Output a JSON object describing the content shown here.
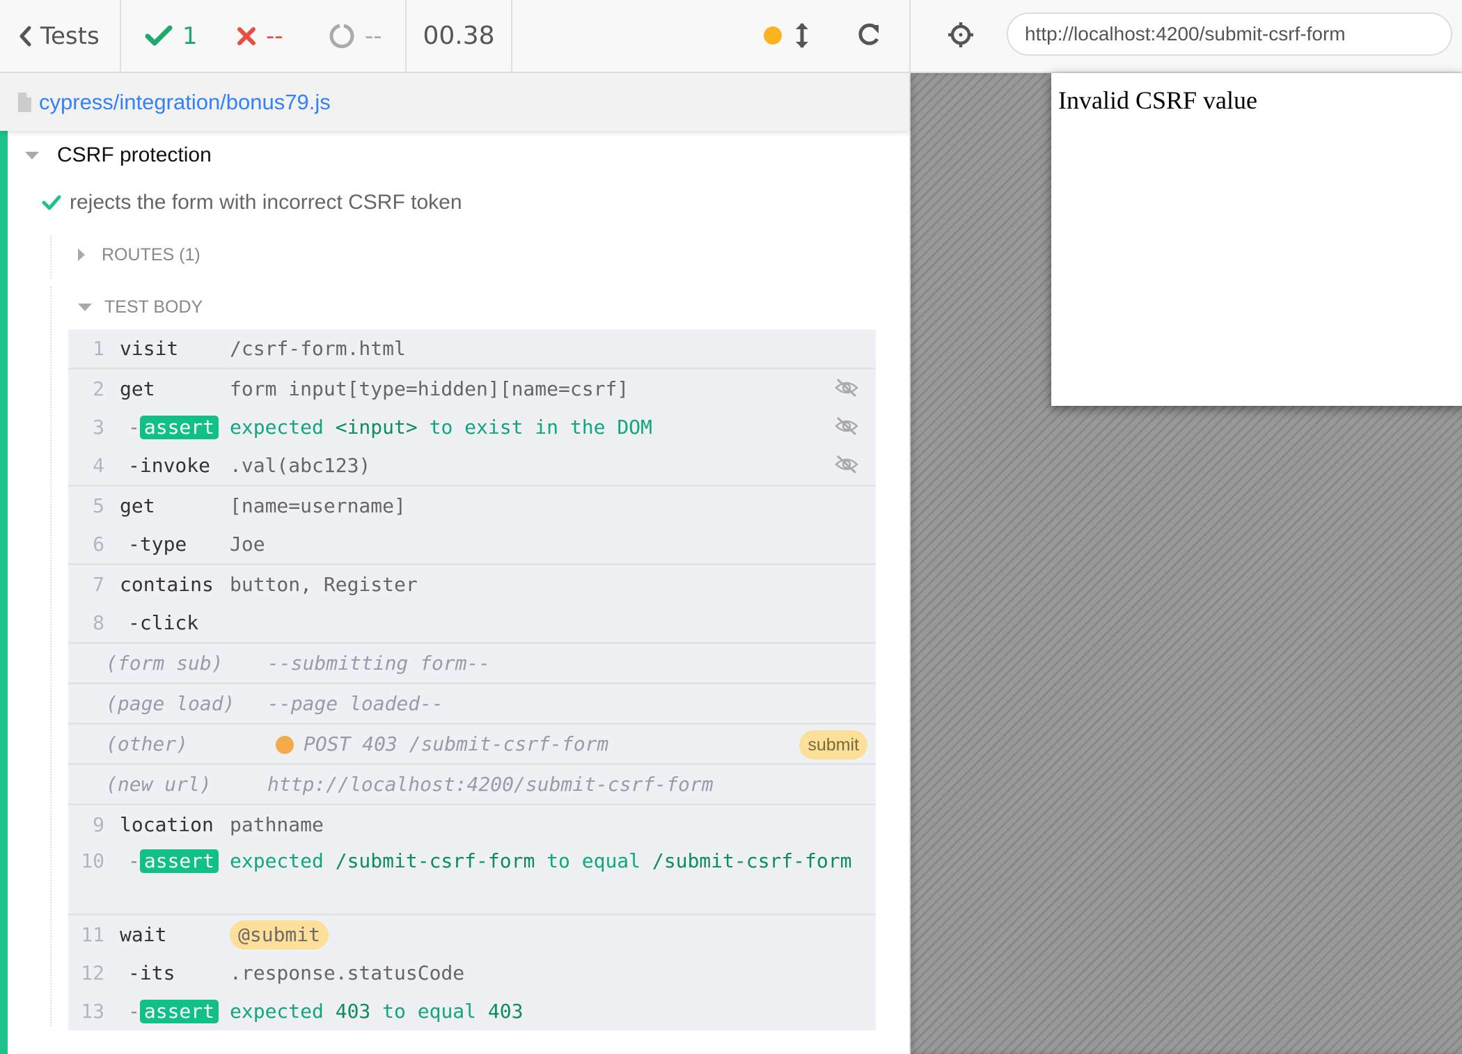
{
  "topbar": {
    "back_label": "Tests",
    "passed": "1",
    "failed": "--",
    "pending": "--",
    "duration": "00.38",
    "status_dot_color": "#fbb421"
  },
  "spec": {
    "path": "cypress/integration/bonus79.js"
  },
  "suite": {
    "title": "CSRF protection",
    "test_title": "rejects the form with incorrect CSRF token",
    "routes_label": "ROUTES (1)",
    "body_label": "TEST BODY"
  },
  "commands": [
    {
      "num": "1",
      "name": "visit",
      "msg": "/csrf-form.html"
    },
    {
      "num": "2",
      "name": "get",
      "msg": "form input[type=hidden][name=csrf]",
      "icon": "eye-slash-icon"
    },
    {
      "num": "3",
      "name": "assert",
      "msg_parts": [
        "expected",
        "<input>",
        "to exist in the DOM"
      ],
      "icon": "eye-slash-icon"
    },
    {
      "num": "4",
      "name": "-invoke",
      "msg": ".val(abc123)",
      "icon": "eye-slash-icon"
    },
    {
      "num": "5",
      "name": "get",
      "msg": "[name=username]"
    },
    {
      "num": "6",
      "name": "-type",
      "msg": "Joe"
    },
    {
      "num": "7",
      "name": "contains",
      "msg": "button, Register"
    },
    {
      "num": "8",
      "name": "-click",
      "msg": ""
    },
    {
      "num": "",
      "name": "(form sub)",
      "msg": "--submitting form--"
    },
    {
      "num": "",
      "name": "(page load)",
      "msg": "--page loaded--"
    },
    {
      "num": "",
      "name": "(other)",
      "msg": "POST 403 /submit-csrf-form",
      "badge": "submit"
    },
    {
      "num": "",
      "name": "(new url)",
      "msg": "http://localhost:4200/submit-csrf-form"
    },
    {
      "num": "9",
      "name": "location",
      "msg": "pathname"
    },
    {
      "num": "10",
      "name": "assert",
      "msg_parts": [
        "expected",
        "/submit-csrf-form",
        "to equal",
        "/submit-csrf-form"
      ]
    },
    {
      "num": "11",
      "name": "wait",
      "msg": "@submit"
    },
    {
      "num": "12",
      "name": "-its",
      "msg": ".response.statusCode"
    },
    {
      "num": "13",
      "name": "assert",
      "msg_parts": [
        "expected",
        "403",
        "to equal",
        "403"
      ]
    }
  ],
  "aut": {
    "url": "http://localhost:4200/submit-csrf-form",
    "page_text": "Invalid CSRF value"
  },
  "colors": {
    "pass": "#1ec28b",
    "fail": "#e94f3f",
    "link": "#3380ff",
    "alias": "#fcdf98"
  }
}
